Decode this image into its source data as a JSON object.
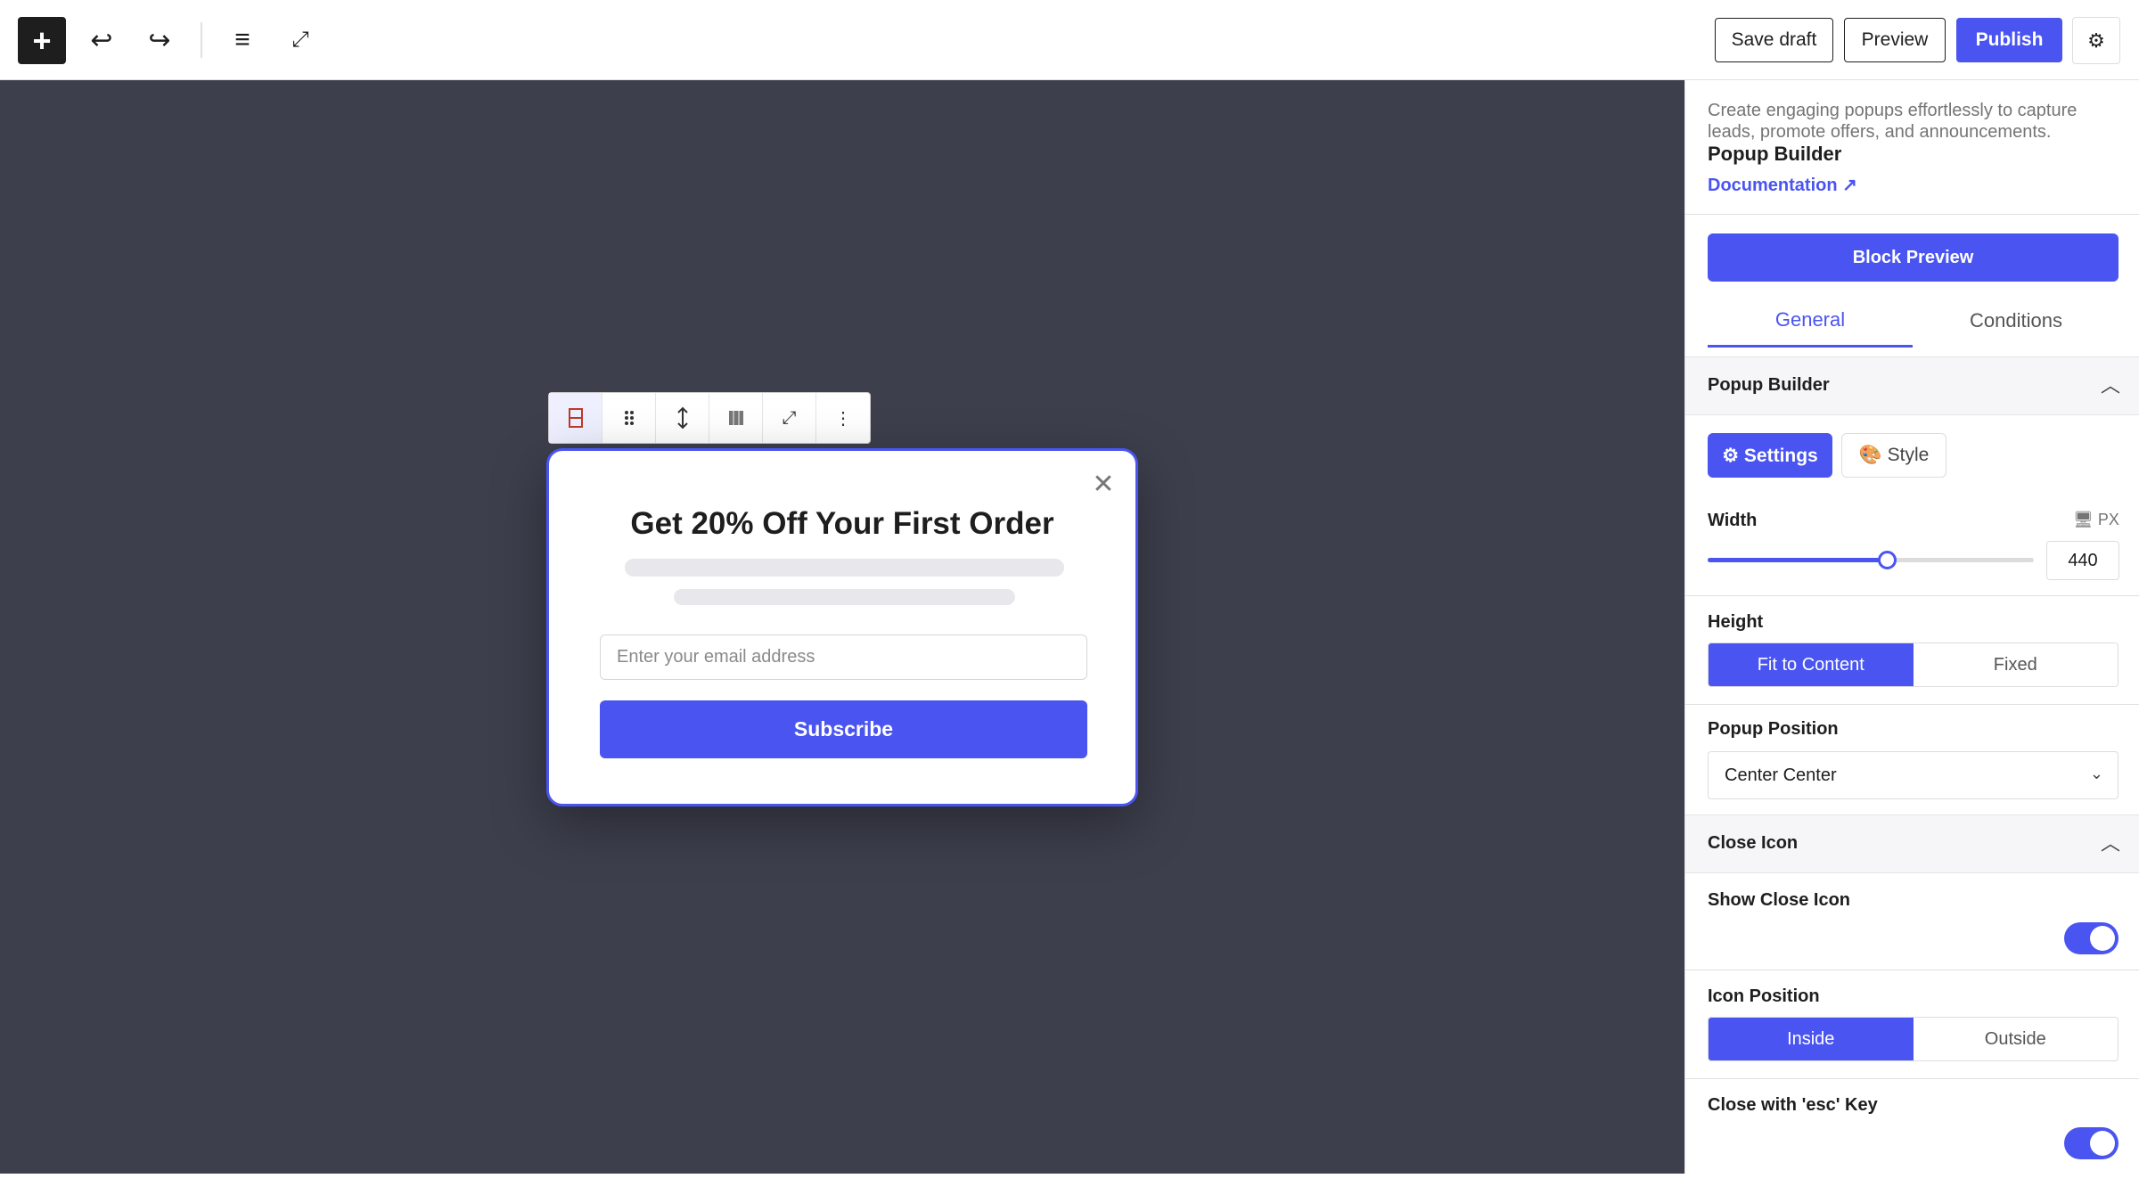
{
  "toolbar": {
    "add_label": "+",
    "undo_icon": "↩",
    "redo_icon": "↪",
    "list_icon": "≡",
    "fullscreen_icon": "⤢",
    "save_draft_label": "Save draft",
    "preview_label": "Preview",
    "publish_label": "Publish",
    "settings_icon": "⚙"
  },
  "block_toolbar": {
    "items": [
      "popup-block-icon",
      "drag-handle-icon",
      "move-vertical-icon",
      "align-icon",
      "fullscreen-icon",
      "more-options-icon"
    ]
  },
  "popup": {
    "close_icon": "✕",
    "title": "Get 20% Off Your First Order",
    "email_placeholder": "Enter your email address",
    "subscribe_label": "Subscribe"
  },
  "sidebar": {
    "description": "Create engaging popups effortlessly to capture leads, promote offers, and announcements.",
    "title": "Popup Builder",
    "documentation_label": "Documentation ↗",
    "block_preview_label": "Block Preview",
    "tabs": [
      {
        "label": "General",
        "active": true
      },
      {
        "label": "Conditions",
        "active": false
      }
    ],
    "popup_builder_section": "Popup Builder",
    "settings_tab_label": "⚙ Settings",
    "style_tab_label": "🎨 Style",
    "width": {
      "label": "Width",
      "unit": "🖥 PX",
      "value": "440",
      "slider_fraction": 0.55
    },
    "height": {
      "label": "Height",
      "options": [
        "Fit to Content",
        "Fixed"
      ],
      "selected": "Fit to Content"
    },
    "popup_position": {
      "label": "Popup Position",
      "value": "Center Center"
    },
    "close_icon_section": "Close Icon",
    "show_close_icon": {
      "label": "Show Close Icon",
      "on": true
    },
    "icon_position": {
      "label": "Icon Position",
      "options": [
        "Inside",
        "Outside"
      ],
      "selected": "Inside"
    },
    "close_esc": {
      "label": "Close with 'esc' Key",
      "on": true
    }
  },
  "colors": {
    "accent": "#4a55f1",
    "canvas": "#3d3f4d"
  }
}
